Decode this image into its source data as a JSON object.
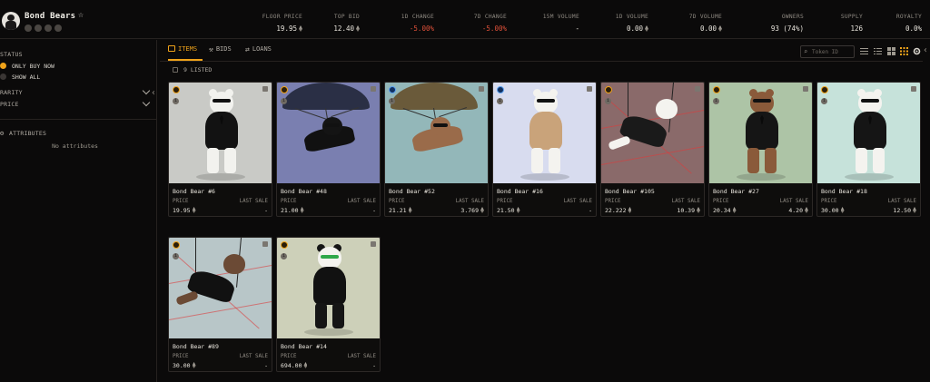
{
  "collection": {
    "title": "Bond Bears",
    "star_icon": "☆",
    "social_icons": [
      "website-icon",
      "discord-icon",
      "twitter-icon",
      "explorer-icon"
    ]
  },
  "stats": [
    {
      "label": "FLOOR PRICE",
      "value": "19.95",
      "eth": true,
      "neg": false
    },
    {
      "label": "TOP BID",
      "value": "12.40",
      "eth": true,
      "neg": false
    },
    {
      "label": "1D CHANGE",
      "value": "-5.00%",
      "eth": false,
      "neg": true
    },
    {
      "label": "7D CHANGE",
      "value": "-5.00%",
      "eth": false,
      "neg": true
    },
    {
      "label": "15M VOLUME",
      "value": "-",
      "eth": false,
      "neg": false
    },
    {
      "label": "1D VOLUME",
      "value": "0.00",
      "eth": true,
      "neg": false
    },
    {
      "label": "7D VOLUME",
      "value": "0.00",
      "eth": true,
      "neg": false
    },
    {
      "label": "OWNERS",
      "value": "93 (74%)",
      "eth": false,
      "neg": false
    },
    {
      "label": "SUPPLY",
      "value": "126",
      "eth": false,
      "neg": false
    },
    {
      "label": "ROYALTY",
      "value": "0.0%",
      "eth": false,
      "neg": false
    }
  ],
  "sidebar": {
    "status_label": "STATUS",
    "options": [
      {
        "label": "ONLY BUY NOW",
        "selected": true
      },
      {
        "label": "SHOW ALL",
        "selected": false
      }
    ],
    "rarity_label": "RARITY",
    "price_label": "PRICE",
    "attributes_label": "ATTRIBUTES",
    "no_attributes": "No attributes"
  },
  "tabs": [
    {
      "label": "ITEMS",
      "active": true
    },
    {
      "label": "BIDS",
      "active": false
    },
    {
      "label": "LOANS",
      "active": false
    }
  ],
  "search": {
    "placeholder": "Token ID"
  },
  "listed_count_label": "9 LISTED",
  "card_labels": {
    "price": "PRICE",
    "last_sale": "LAST SALE"
  },
  "cards": [
    {
      "name": "Bond Bear #6",
      "price": "19.95",
      "last_sale": "-",
      "bg": "#c9cac6",
      "bear": "#f2f2ee",
      "badge": "orange",
      "pose": "standing",
      "suit": "#121212"
    },
    {
      "name": "Bond Bear #48",
      "price": "21.00",
      "last_sale": "-",
      "bg": "#7a7fb0",
      "bear": "#111111",
      "badge": "orange",
      "pose": "parachute",
      "suit": "#111111",
      "chute": "#2a2f45"
    },
    {
      "name": "Bond Bear #52",
      "price": "21.21",
      "last_sale": "3.769",
      "bg": "#93b7b9",
      "bear": "#9a6b4a",
      "badge": "blue",
      "pose": "parachute",
      "suit": "#9a6b4a",
      "chute": "#6a5a3a"
    },
    {
      "name": "Bond Bear #16",
      "price": "21.50",
      "last_sale": "-",
      "bg": "#d8dcef",
      "bear": "#f4f3ef",
      "badge": "blue",
      "pose": "trench",
      "suit": "#c9a37a"
    },
    {
      "name": "Bond Bear #105",
      "price": "22.222",
      "last_sale": "10.39",
      "bg": "#8a6a6a",
      "bear": "#f4f3ef",
      "badge": "orange",
      "pose": "swing",
      "suit": "#1a1a1a"
    },
    {
      "name": "Bond Bear #27",
      "price": "20.34",
      "last_sale": "4.20",
      "bg": "#adc4a6",
      "bear": "#8a5a3a",
      "badge": "orange",
      "pose": "standing",
      "suit": "#151515"
    },
    {
      "name": "Bond Bear #18",
      "price": "30.00",
      "last_sale": "12.50",
      "bg": "#c6e2da",
      "bear": "#f4f3ef",
      "badge": "orange",
      "pose": "standing",
      "suit": "#151515"
    },
    {
      "name": "Bond Bear #89",
      "price": "30.00",
      "last_sale": "-",
      "bg": "#b8c6c8",
      "bear": "#6b4a35",
      "badge": "orange",
      "pose": "swing",
      "suit": "#111111"
    },
    {
      "name": "Bond Bear #14",
      "price": "694.00",
      "last_sale": "-",
      "bg": "#cdd0b9",
      "bear": "#151515",
      "badge": "orange",
      "pose": "panda",
      "suit": "#111111"
    }
  ]
}
